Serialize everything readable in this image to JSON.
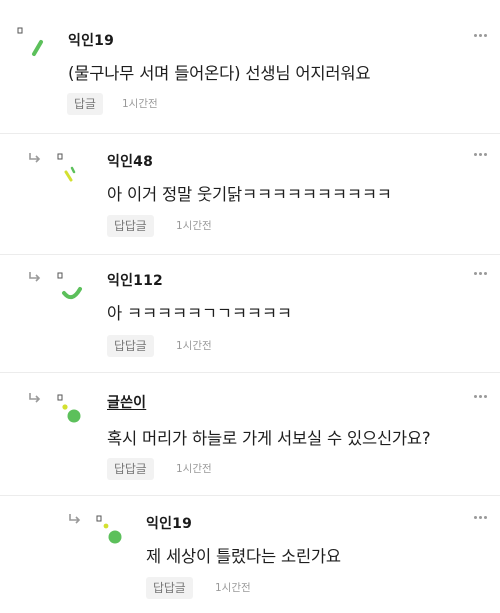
{
  "colors": {
    "avatar_green": "#5cc05b",
    "avatar_yellow": "#d3e030",
    "text_primary": "#1e1e1e",
    "text_muted": "#9a9a9a",
    "reply_button_bg": "#f2f2f2"
  },
  "comments": [
    {
      "author": "익인19",
      "text": "(물구나무 서며 들어온다) 선생님 어지러워요",
      "reply_label": "답글",
      "time": "1시간전",
      "is_reply": false,
      "is_op": false
    },
    {
      "author": "익인48",
      "text": "아 이거 정말 웃기닭ㅋㅋㅋㅋㅋㅋㅋㅋㅋㅋ",
      "reply_label": "답답글",
      "time": "1시간전",
      "is_reply": true,
      "is_op": false
    },
    {
      "author": "익인112",
      "text": "아 ㅋㅋㅋㅋㅋㄱㄱㅋㅋㅋㅋ",
      "reply_label": "답답글",
      "time": "1시간전",
      "is_reply": true,
      "is_op": false
    },
    {
      "author": "글쓴이",
      "text": "혹시 머리가 하늘로 가게 서보실 수 있으신가요?",
      "reply_label": "답답글",
      "time": "1시간전",
      "is_reply": true,
      "is_op": true
    },
    {
      "author": "익인19",
      "text": "제 세상이 틀렸다는 소린가요",
      "reply_label": "답답글",
      "time": "1시간전",
      "is_reply": true,
      "is_op": false
    }
  ]
}
